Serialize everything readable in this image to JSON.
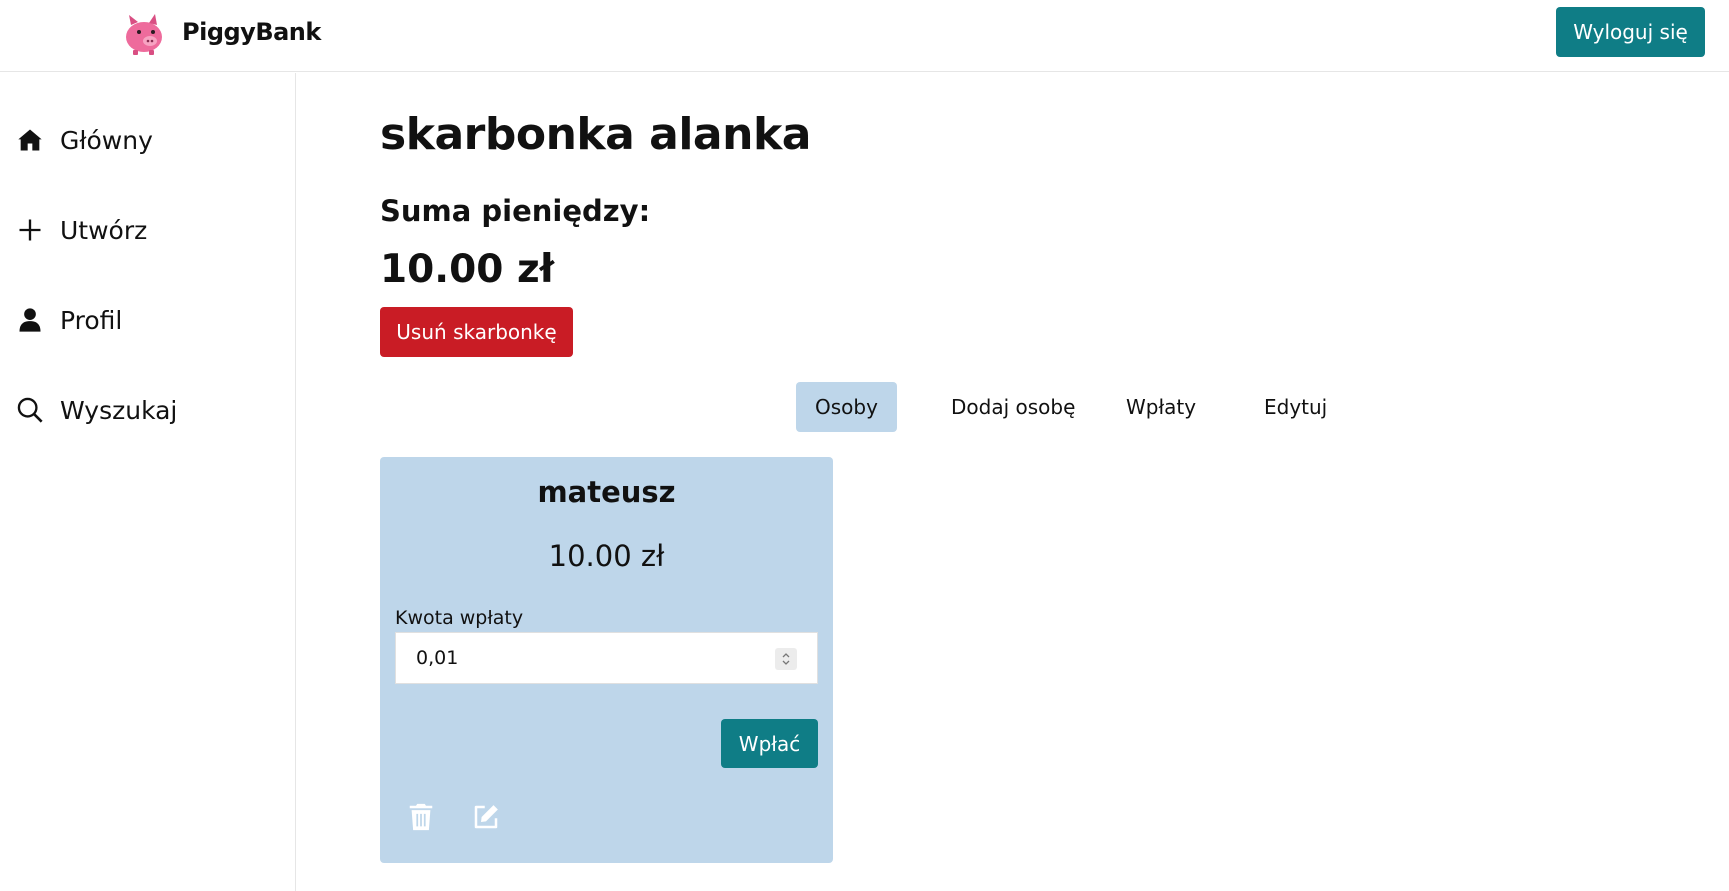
{
  "header": {
    "brand": "PiggyBank",
    "logout_label": "Wyloguj się"
  },
  "sidebar": {
    "items": [
      {
        "label": "Główny",
        "icon": "home-icon"
      },
      {
        "label": "Utwórz",
        "icon": "plus-icon"
      },
      {
        "label": "Profil",
        "icon": "user-icon"
      },
      {
        "label": "Wyszukaj",
        "icon": "search-icon"
      }
    ]
  },
  "main": {
    "title": "skarbonka alanka",
    "sum_label": "Suma pieniędzy:",
    "sum_value": "10.00 zł",
    "delete_label": "Usuń skarbonkę",
    "tabs": [
      {
        "label": "Osoby",
        "active": true
      },
      {
        "label": "Dodaj osobę",
        "active": false
      },
      {
        "label": "Wpłaty",
        "active": false
      },
      {
        "label": "Edytuj",
        "active": false
      }
    ],
    "person_card": {
      "name": "mateusz",
      "amount": "10.00 zł",
      "input_label": "Kwota wpłaty",
      "input_value": "0,01",
      "deposit_label": "Wpłać",
      "icons": [
        "trash-icon",
        "edit-icon"
      ]
    }
  },
  "colors": {
    "accent": "#0f7d86",
    "danger": "#c91c25",
    "card_bg": "#bed6ea",
    "logo_pink": "#ee6b9c"
  }
}
